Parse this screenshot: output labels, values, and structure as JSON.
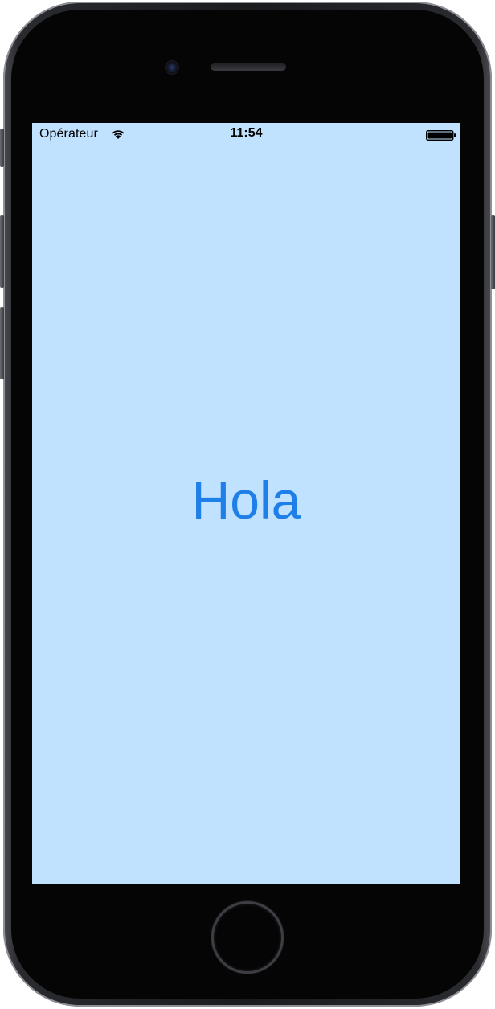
{
  "status_bar": {
    "carrier": "Opérateur",
    "time": "11:54",
    "wifi_icon": "wifi-icon",
    "battery_icon": "battery-icon"
  },
  "screen": {
    "greeting": "Hola",
    "background_color": "#c0e2ff",
    "text_color": "#1e7fe8"
  },
  "device": {
    "home_button_icon": "home-button",
    "camera_icon": "front-camera-icon",
    "speaker_icon": "earpiece-speaker-icon"
  }
}
